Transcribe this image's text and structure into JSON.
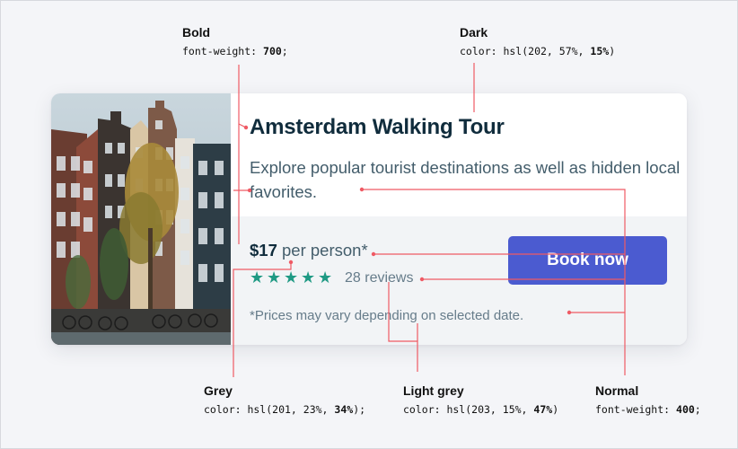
{
  "annotations": {
    "bold": {
      "title": "Bold",
      "code_prefix": "font-weight: ",
      "code_value": "700",
      "code_suffix": ";"
    },
    "dark": {
      "title": "Dark",
      "code_prefix": "color: hsl(202, 57%, ",
      "code_value": "15%",
      "code_suffix": ")"
    },
    "grey": {
      "title": "Grey",
      "code_prefix": "color: hsl(201, 23%, ",
      "code_value": "34%",
      "code_suffix": ");"
    },
    "light_grey": {
      "title": "Light grey",
      "code_prefix": "color: hsl(203, 15%, ",
      "code_value": "47%",
      "code_suffix": ")"
    },
    "normal": {
      "title": "Normal",
      "code_prefix": "font-weight: ",
      "code_value": "400",
      "code_suffix": ";"
    }
  },
  "card": {
    "title": "Amsterdam Walking Tour",
    "description": "Explore popular tourist destinations as well as hidden local favorites.",
    "price_amount": "$17",
    "price_unit": " per person*",
    "rating_stars": 5,
    "reviews": "28 reviews",
    "note": "*Prices may vary depending on selected date.",
    "button_label": "Book now"
  },
  "colors": {
    "dark": "hsl(202,57%,15%)",
    "grey": "hsl(201,23%,34%)",
    "light_grey": "hsl(203,15%,47%)",
    "button": "#4b5bd0",
    "star": "#1f9a84",
    "annotation_line": "#ef5a64"
  },
  "icons": {
    "star": "star-icon"
  }
}
